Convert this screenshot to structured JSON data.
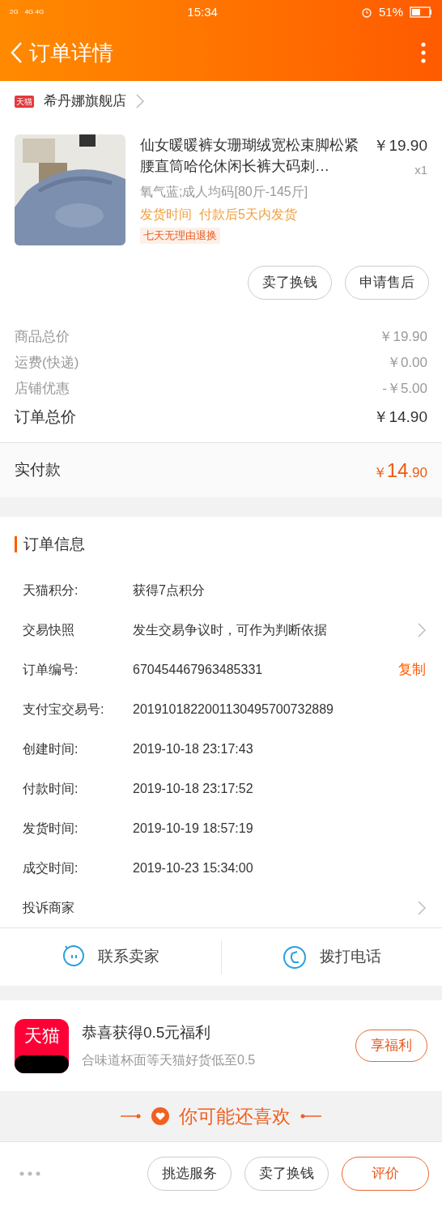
{
  "status_bar": {
    "network_1": "2G",
    "network_2": "4G 4G",
    "time": "15:34",
    "battery": "51%"
  },
  "header": {
    "title": "订单详情"
  },
  "shop": {
    "badge": "天猫",
    "name": "希丹娜旗舰店"
  },
  "product": {
    "title": "仙女暖暖裤女珊瑚绒宽松束脚松紧腰直筒哈伦休闲长裤大码刺…",
    "price": "￥19.90",
    "quantity": "x1",
    "sku": "氧气蓝;成人均码[80斤-145斤]",
    "shipping": "发货时间  付款后5天内发货",
    "tag": "七天无理由退换"
  },
  "item_buttons": [
    "卖了换钱",
    "申请售后"
  ],
  "price_rows": [
    {
      "label": "商品总价",
      "value": "￥19.90",
      "kind": "minor"
    },
    {
      "label": "运费(快递)",
      "value": "￥0.00",
      "kind": "minor"
    },
    {
      "label": "店铺优惠",
      "value": "-￥5.00",
      "kind": "minor"
    },
    {
      "label": "订单总价",
      "value": "￥14.90",
      "kind": "total"
    }
  ],
  "paid": {
    "label": "实付款",
    "currency": "￥",
    "integer": "14",
    "decimal": ".90"
  },
  "order_info": {
    "title": "订单信息",
    "rows": [
      {
        "label": "天猫积分:",
        "value": "获得7点积分",
        "kind": "plain"
      },
      {
        "label": "交易快照",
        "value": "发生交易争议时，可作为判断依据",
        "kind": "chevron"
      },
      {
        "label": "订单编号:",
        "value": "670454467963485331",
        "kind": "copy",
        "action": "复制"
      },
      {
        "label": "支付宝交易号:",
        "value": "2019101822001130495700732889",
        "kind": "plain"
      },
      {
        "label": "创建时间:",
        "value": "2019-10-18 23:17:43",
        "kind": "plain"
      },
      {
        "label": "付款时间:",
        "value": "2019-10-18 23:17:52",
        "kind": "plain"
      },
      {
        "label": "发货时间:",
        "value": "2019-10-19 18:57:19",
        "kind": "plain"
      },
      {
        "label": "成交时间:",
        "value": "2019-10-23 15:34:00",
        "kind": "plain"
      },
      {
        "label": "投诉商家",
        "value": "",
        "kind": "chevron"
      }
    ]
  },
  "contact": [
    {
      "label": "联系卖家",
      "kind": "chat"
    },
    {
      "label": "拨打电话",
      "kind": "phone"
    }
  ],
  "promo": {
    "logo": "天猫",
    "title": "恭喜获得0.5元福利",
    "subtitle": "合味道杯面等天猫好货低至0.5",
    "button": "享福利"
  },
  "recommend": {
    "title": "你可能还喜欢"
  },
  "bottom_bar": {
    "buttons": [
      {
        "label": "挑选服务",
        "kind": "normal"
      },
      {
        "label": "卖了换钱",
        "kind": "normal"
      },
      {
        "label": "评价",
        "kind": "primary"
      }
    ]
  }
}
